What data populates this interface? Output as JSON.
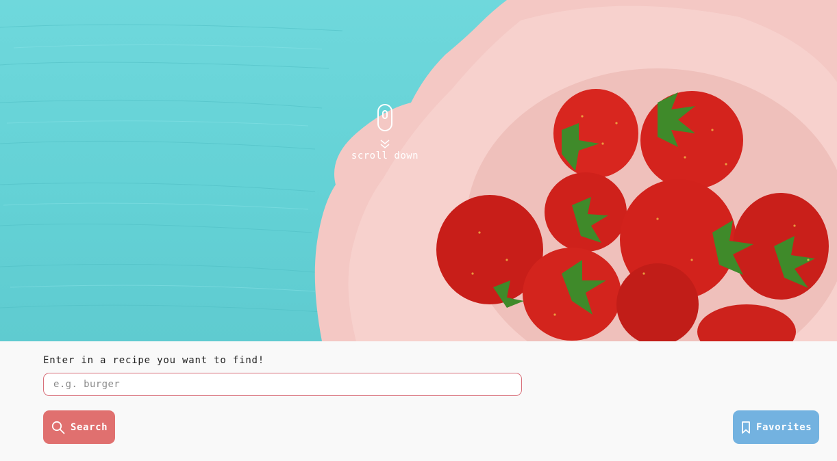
{
  "hero": {
    "scroll_label": "scroll down",
    "icons": [
      "mouse-scroll-icon",
      "double-chevron-down-icon"
    ]
  },
  "search": {
    "prompt": "Enter in a recipe you want to find!",
    "placeholder": "e.g. burger",
    "value": "",
    "button_label": "Search",
    "button_icon": "search-icon"
  },
  "favorites": {
    "button_label": "Favorites",
    "button_icon": "bookmark-icon"
  },
  "colors": {
    "accent_red": "#e0706f",
    "accent_blue": "#73b2e0",
    "input_border": "#d8707a",
    "background": "#f9f9f9",
    "hero_teal": "#63d1d5"
  }
}
